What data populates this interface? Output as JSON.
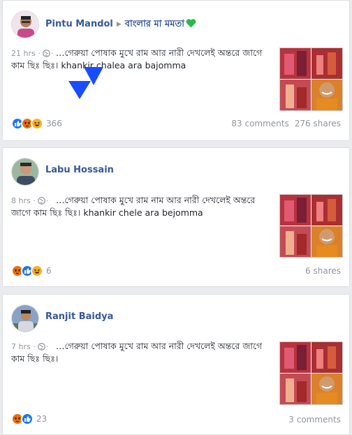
{
  "posts": [
    {
      "author": "Pintu Mandol",
      "group": "বাংলার মা মমতা",
      "time": "21 hrs",
      "dot": "·",
      "text": "…গেরুয়া পোষাক মুখে রাম আর নারী দেখলেই অন্তরে জাগে কাম ছিঃ ছিঃ। khankir chalea ara bajomma",
      "reactions": [
        "like",
        "angry",
        "haha"
      ],
      "reaction_count": "366",
      "comments": "83 comments",
      "shares": "276 shares"
    },
    {
      "author": "Labu Hossain",
      "time": "8 hrs",
      "dot": "·",
      "text": "…গেরুয়া পোষাক মুখে রাম নাম আর নারী দেখলেই অন্তরে জাগে কাম ছিঃ ছিঃ। khankir chele ara bejomma",
      "reactions": [
        "angry",
        "like",
        "haha"
      ],
      "reaction_count": "6",
      "comments": "",
      "shares": "6 shares"
    },
    {
      "author": "Ranjit Baidya",
      "time": "7 hrs",
      "dot": "·",
      "text": "…গেরুয়া পোষাক মুখে রাম আর নারী দেখলেই অন্তরে জাগে কাম ছিঃ ছিঃ।",
      "reactions": [
        "angry",
        "like"
      ],
      "reaction_count": "23",
      "comments": "3 comments",
      "shares": ""
    }
  ],
  "colors": {
    "link": "#365899",
    "muted": "#90949c",
    "like": "#1877f2",
    "angry": "#e9710f",
    "haha": "#f7b125",
    "heart": "#2db84d",
    "cursor": "#1a4cff"
  }
}
